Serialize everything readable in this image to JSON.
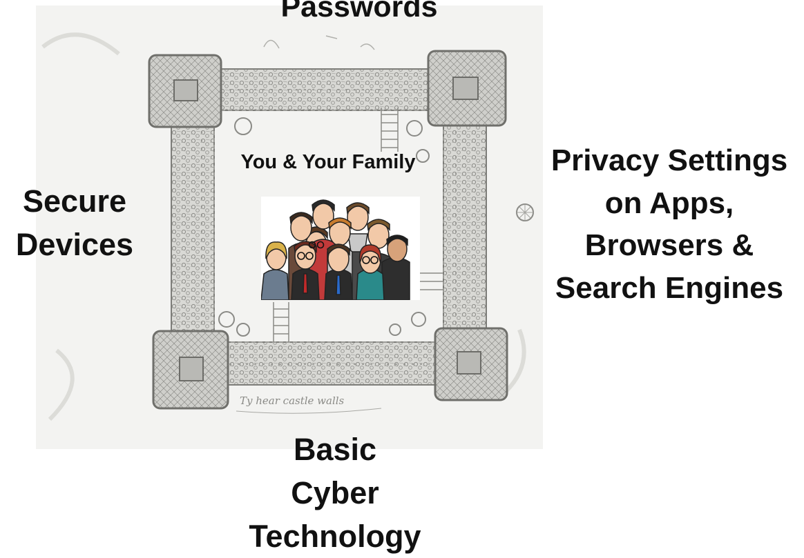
{
  "labels": {
    "top": "Passwords",
    "left": [
      "Secure",
      "Devices"
    ],
    "right": [
      "Privacy Settings",
      "on Apps,",
      "Browsers &",
      "Search Engines"
    ],
    "bottom": [
      "Basic",
      "Cyber",
      "Technology"
    ],
    "center": "You & Your Family"
  },
  "sketch": {
    "caption": "Ty hear castle walls",
    "description_icon": "castle-floorplan-sketch"
  },
  "family": {
    "icon": "family-group-illustration"
  },
  "colors": {
    "text": "#111111",
    "sketch_background": "#f4f4f2",
    "sketch_stroke": "#8d8d89"
  }
}
